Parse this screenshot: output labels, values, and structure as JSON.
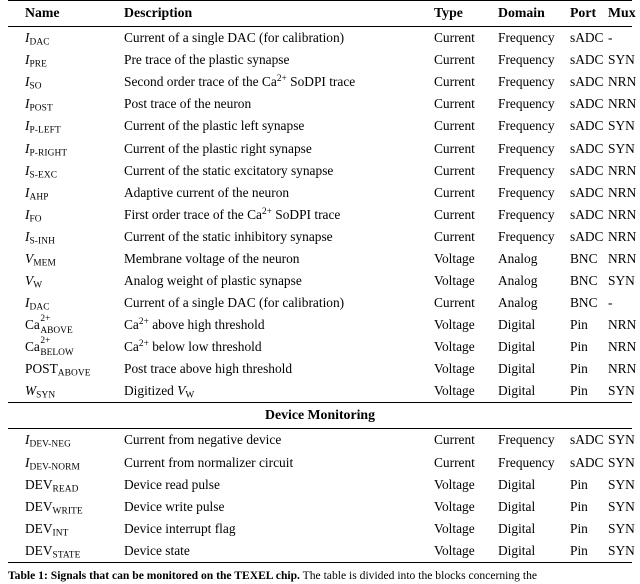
{
  "table": {
    "columns": [
      "Name",
      "Description",
      "Type",
      "Domain",
      "Port",
      "Mux"
    ],
    "section_header": "Device Monitoring",
    "rows": [
      {
        "name_base": "I",
        "name_sub": "DAC",
        "name_sup": "",
        "desc": "Current of a single DAC (for calibration)",
        "type": "Current",
        "domain": "Frequency",
        "port": "sADC",
        "mux": "-"
      },
      {
        "name_base": "I",
        "name_sub": "PRE",
        "name_sup": "",
        "desc": "Pre trace of the plastic synapse",
        "type": "Current",
        "domain": "Frequency",
        "port": "sADC",
        "mux": "SYN"
      },
      {
        "name_base": "I",
        "name_sub": "SO",
        "name_sup": "",
        "desc": "Second order trace of the Ca2+ SoDPI trace",
        "desc_rich": "so",
        "type": "Current",
        "domain": "Frequency",
        "port": "sADC",
        "mux": "NRN"
      },
      {
        "name_base": "I",
        "name_sub": "POST",
        "name_sup": "",
        "desc": "Post trace of the neuron",
        "type": "Current",
        "domain": "Frequency",
        "port": "sADC",
        "mux": "NRN"
      },
      {
        "name_base": "I",
        "name_sub": "P-LEFT",
        "name_sup": "",
        "desc": "Current of the plastic left synapse",
        "type": "Current",
        "domain": "Frequency",
        "port": "sADC",
        "mux": "SYN"
      },
      {
        "name_base": "I",
        "name_sub": "P-RIGHT",
        "name_sup": "",
        "desc": "Current of the plastic right synapse",
        "type": "Current",
        "domain": "Frequency",
        "port": "sADC",
        "mux": "SYN"
      },
      {
        "name_base": "I",
        "name_sub": "S-EXC",
        "name_sup": "",
        "desc": "Current of the static excitatory synapse",
        "type": "Current",
        "domain": "Frequency",
        "port": "sADC",
        "mux": "NRN"
      },
      {
        "name_base": "I",
        "name_sub": "AHP",
        "name_sup": "",
        "desc": "Adaptive current of the neuron",
        "type": "Current",
        "domain": "Frequency",
        "port": "sADC",
        "mux": "NRN"
      },
      {
        "name_base": "I",
        "name_sub": "FO",
        "name_sup": "",
        "desc": "First order trace of the Ca2+ SoDPI trace",
        "desc_rich": "fo",
        "type": "Current",
        "domain": "Frequency",
        "port": "sADC",
        "mux": "NRN"
      },
      {
        "name_base": "I",
        "name_sub": "S-INH",
        "name_sup": "",
        "desc": "Current of the static inhibitory synapse",
        "type": "Current",
        "domain": "Frequency",
        "port": "sADC",
        "mux": "NRN"
      },
      {
        "name_base": "V",
        "name_sub": "MEM",
        "name_sup": "",
        "desc": "Membrane voltage of the neuron",
        "type": "Voltage",
        "domain": "Analog",
        "port": "BNC",
        "mux": "NRN"
      },
      {
        "name_base": "V",
        "name_sub": "W",
        "name_sup": "",
        "desc": "Analog weight of plastic synapse",
        "type": "Voltage",
        "domain": "Analog",
        "port": "BNC",
        "mux": "SYN"
      },
      {
        "name_base": "I",
        "name_sub": "DAC",
        "name_sup": "",
        "desc": "Current of a single DAC (for calibration)",
        "type": "Current",
        "domain": "Analog",
        "port": "BNC",
        "mux": "-"
      },
      {
        "name_base": "Ca",
        "name_upright": true,
        "name_sub": "ABOVE",
        "name_sup": "2+",
        "desc": "Ca2+ above high threshold",
        "desc_rich": "ca_above",
        "type": "Voltage",
        "domain": "Digital",
        "port": "Pin",
        "mux": "NRN"
      },
      {
        "name_base": "Ca",
        "name_upright": true,
        "name_sub": "BELOW",
        "name_sup": "2+",
        "desc": "Ca2+ below low threshold",
        "desc_rich": "ca_below",
        "type": "Voltage",
        "domain": "Digital",
        "port": "Pin",
        "mux": "NRN"
      },
      {
        "name_base": "POST",
        "name_upright": true,
        "name_sub": "ABOVE",
        "name_sup": "",
        "desc": "Post trace above high threshold",
        "type": "Voltage",
        "domain": "Digital",
        "port": "Pin",
        "mux": "NRN"
      },
      {
        "name_base": "W",
        "name_sub": "SYN",
        "name_sup": "",
        "desc": "Digitized VW",
        "desc_rich": "digitized_vw",
        "type": "Voltage",
        "domain": "Digital",
        "port": "Pin",
        "mux": "SYN"
      }
    ],
    "device_rows": [
      {
        "name_base": "I",
        "name_sub": "DEV-NEG",
        "name_sup": "",
        "desc": "Current from negative device",
        "type": "Current",
        "domain": "Frequency",
        "port": "sADC",
        "mux": "SYN"
      },
      {
        "name_base": "I",
        "name_sub": "DEV-NORM",
        "name_sup": "",
        "desc": "Current from normalizer circuit",
        "type": "Current",
        "domain": "Frequency",
        "port": "sADC",
        "mux": "SYN"
      },
      {
        "name_base": "DEV",
        "name_upright": true,
        "name_sub": "READ",
        "name_sup": "",
        "desc": "Device read pulse",
        "type": "Voltage",
        "domain": "Digital",
        "port": "Pin",
        "mux": "SYN"
      },
      {
        "name_base": "DEV",
        "name_upright": true,
        "name_sub": "WRITE",
        "name_sup": "",
        "desc": "Device write pulse",
        "type": "Voltage",
        "domain": "Digital",
        "port": "Pin",
        "mux": "SYN"
      },
      {
        "name_base": "DEV",
        "name_upright": true,
        "name_sub": "INT",
        "name_sup": "",
        "desc": "Device interrupt flag",
        "type": "Voltage",
        "domain": "Digital",
        "port": "Pin",
        "mux": "SYN"
      },
      {
        "name_base": "DEV",
        "name_upright": true,
        "name_sub": "STATE",
        "name_sup": "",
        "desc": "Device state",
        "type": "Voltage",
        "domain": "Digital",
        "port": "Pin",
        "mux": "SYN"
      }
    ]
  },
  "caption": {
    "label": "Table 1:",
    "bold_lead": "Signals that can be monitored on the TEXEL chip.",
    "rest": " The table is divided into the blocks concerning the"
  },
  "rich_fragments": {
    "so": [
      "Second order trace of the Ca",
      "2+",
      " SoDPI trace"
    ],
    "fo": [
      "First order trace of the Ca",
      "2+",
      " SoDPI trace"
    ],
    "ca_above": [
      "Ca",
      "2+",
      " above high threshold"
    ],
    "ca_below": [
      "Ca",
      "2+",
      " below low threshold"
    ],
    "digitized_vw": [
      "Digitized ",
      "V",
      "W"
    ]
  }
}
